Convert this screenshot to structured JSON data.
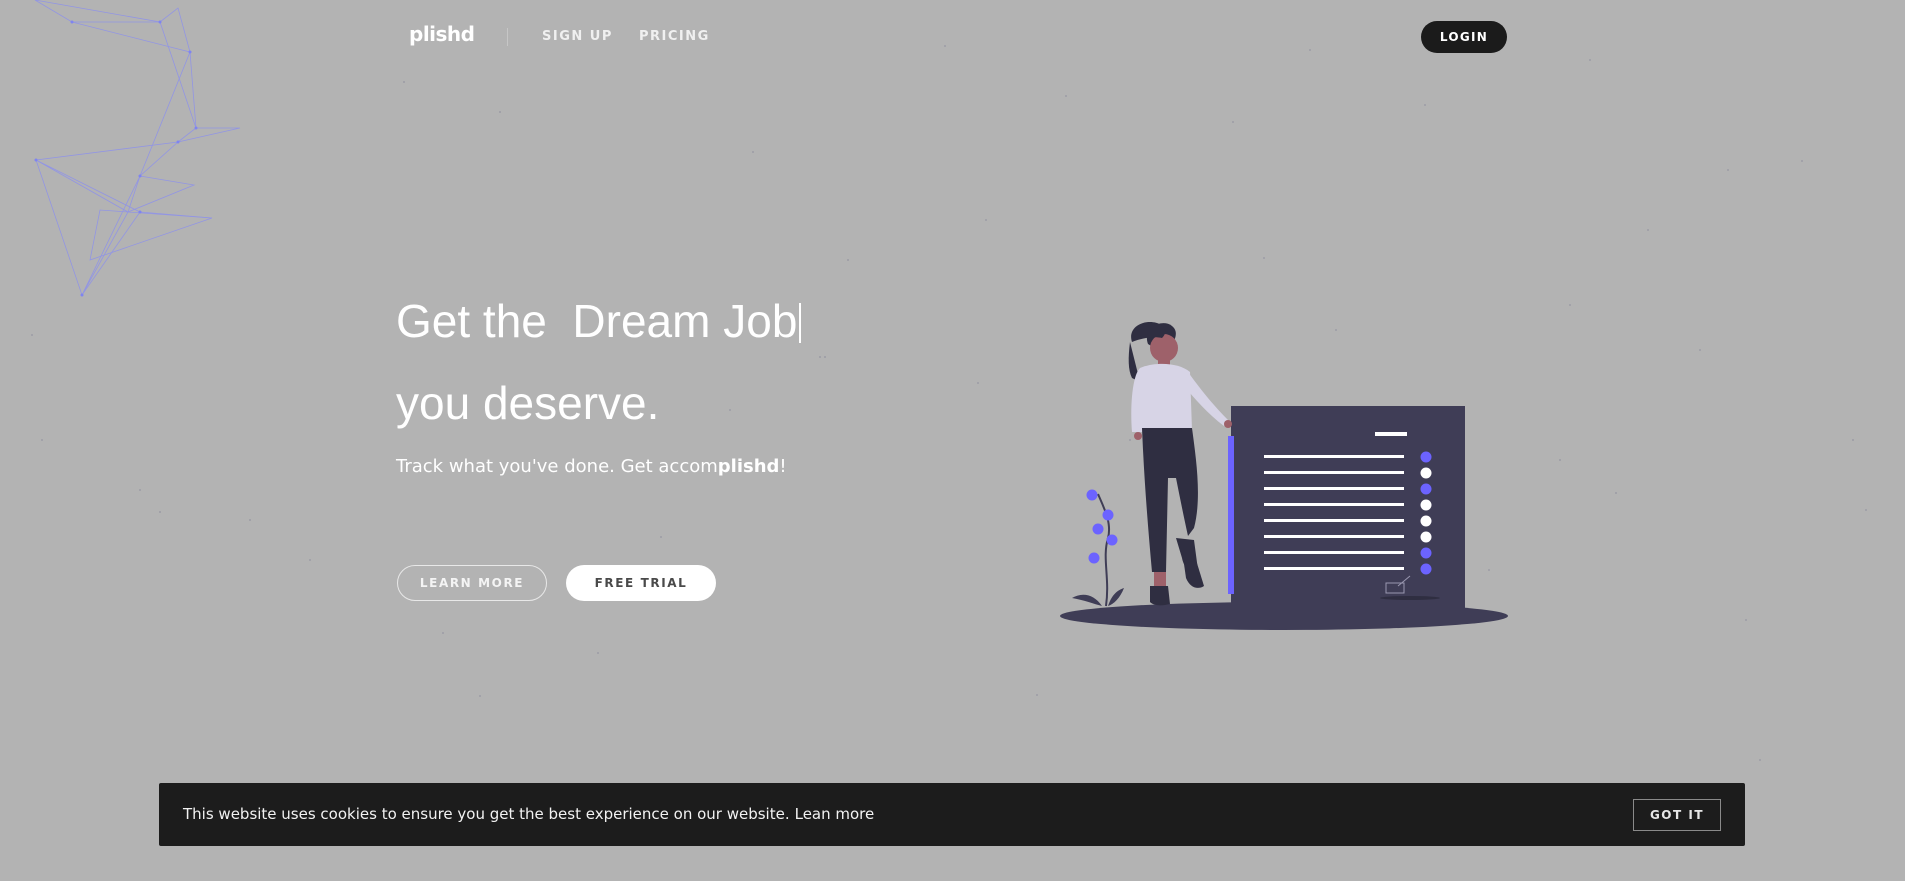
{
  "nav": {
    "brand": "plishd",
    "links": [
      "SIGN UP",
      "PRICING"
    ],
    "login_label": "LOGIN"
  },
  "hero": {
    "title_line1": "Get the  Dream Job",
    "title_line2": "you deserve.",
    "subtitle_pre": "Track what you've done. Get accom",
    "subtitle_bold": "plishd",
    "subtitle_post": "!",
    "learn_more": "LEARN MORE",
    "free_trial": "FREE TRIAL"
  },
  "cookie": {
    "message": "This website uses cookies to ensure you get the best experience on our website.",
    "link": "Lean more",
    "button": "GOT IT"
  },
  "colors": {
    "background": "#b3b3b3",
    "accent_purple": "#6c63ff",
    "dark_panel": "#3f3d56",
    "cookie_bar": "#1c1c1c"
  },
  "icons": [
    "network-lines-decoration",
    "person-with-document-illustration"
  ]
}
